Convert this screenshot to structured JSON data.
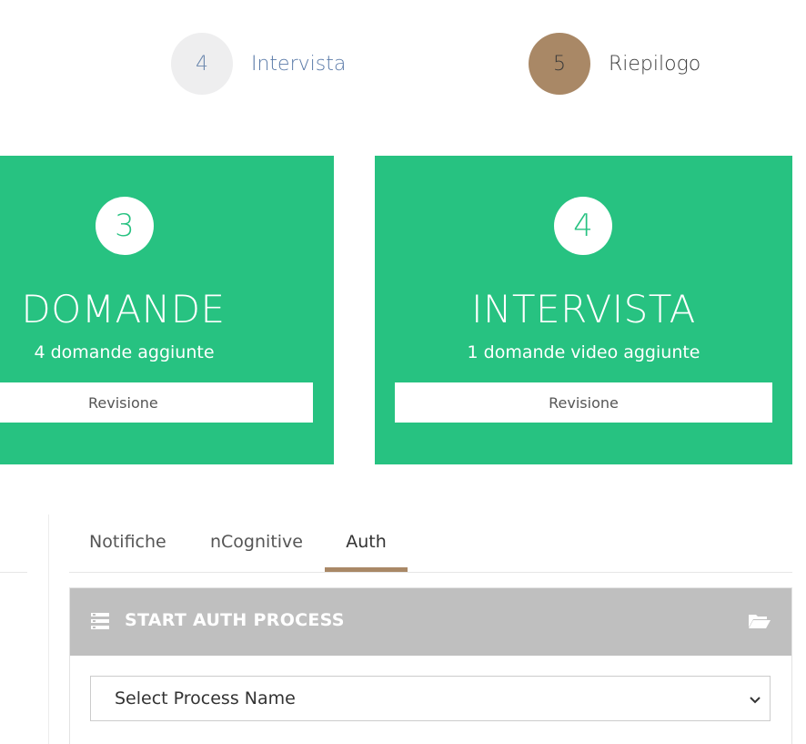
{
  "stepper": {
    "step4": {
      "number": "4",
      "label": "Intervista"
    },
    "step5": {
      "number": "5",
      "label": "Riepilogo"
    }
  },
  "cards": [
    {
      "number": "3",
      "title": "DOMANDE",
      "subtitle": "4 domande aggiunte",
      "button": "Revisione"
    },
    {
      "number": "4",
      "title": "INTERVISTA",
      "subtitle": "1 domande video aggiunte",
      "button": "Revisione"
    }
  ],
  "tabs": [
    {
      "label": "Notifiche"
    },
    {
      "label": "nCognitive"
    },
    {
      "label": "Auth"
    }
  ],
  "active_tab": "Auth",
  "panel": {
    "title": "START AUTH PROCESS",
    "header_icon": "list-icon",
    "action_icon": "folder-open-icon"
  },
  "process_select": {
    "selected": "Select Process Name",
    "icon": "chevron-down-icon"
  },
  "colors": {
    "card_green": "#27c281",
    "accent_brown": "#a98866",
    "step_inactive": "#eeeeef",
    "step_link_blue": "#5a7aa8",
    "panel_header_gray": "#bfbfbf"
  }
}
